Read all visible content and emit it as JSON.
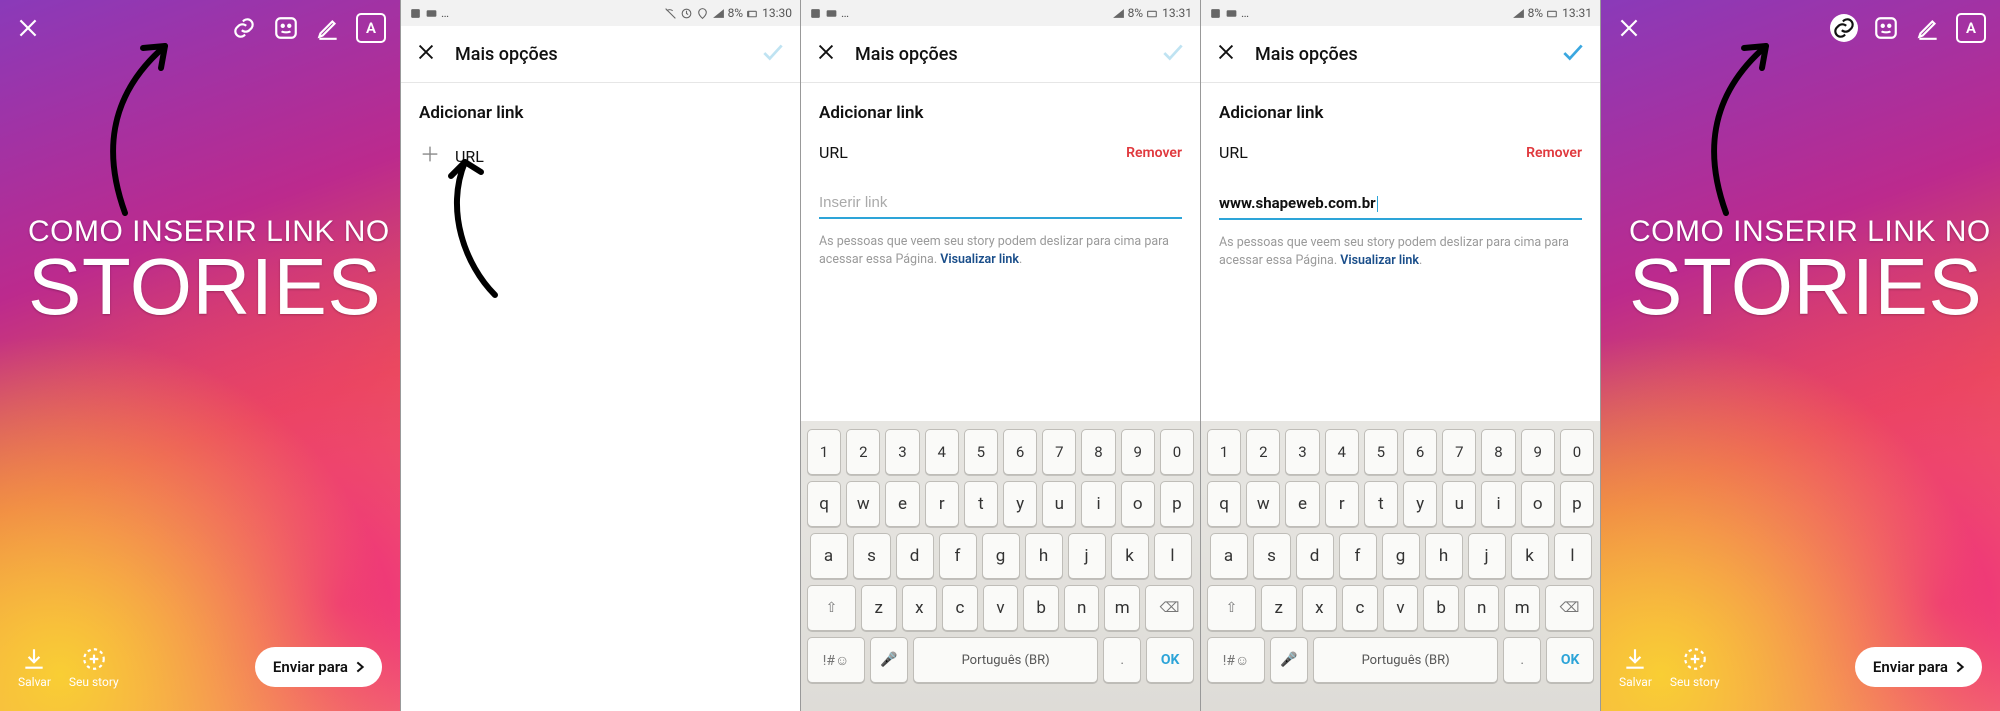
{
  "story": {
    "line1": "COMO INSERIR LINK NO",
    "line2": "STORIES",
    "salvar": "Salvar",
    "seu_story": "Seu story",
    "enviar": "Enviar para"
  },
  "status": {
    "battery": "8%",
    "t30": "13:30",
    "t31": "13:31"
  },
  "mo": {
    "title": "Mais opções",
    "section": "Adicionar link",
    "url_label": "URL",
    "remover": "Remover",
    "placeholder": "Inserir link",
    "value": "www.shapeweb.com.br",
    "hint_a": "As pessoas que veem seu story podem deslizar para cima para acessar essa Página.",
    "hint_link": "Visualizar link"
  },
  "kb": {
    "nums": [
      "1",
      "2",
      "3",
      "4",
      "5",
      "6",
      "7",
      "8",
      "9",
      "0"
    ],
    "r1": [
      "q",
      "w",
      "e",
      "r",
      "t",
      "y",
      "u",
      "i",
      "o",
      "p"
    ],
    "r2": [
      "a",
      "s",
      "d",
      "f",
      "g",
      "h",
      "j",
      "k",
      "l"
    ],
    "r3": [
      "z",
      "x",
      "c",
      "v",
      "b",
      "n",
      "m"
    ],
    "sym": "!#☺",
    "lang": "Português (BR)",
    "ok": "OK"
  }
}
